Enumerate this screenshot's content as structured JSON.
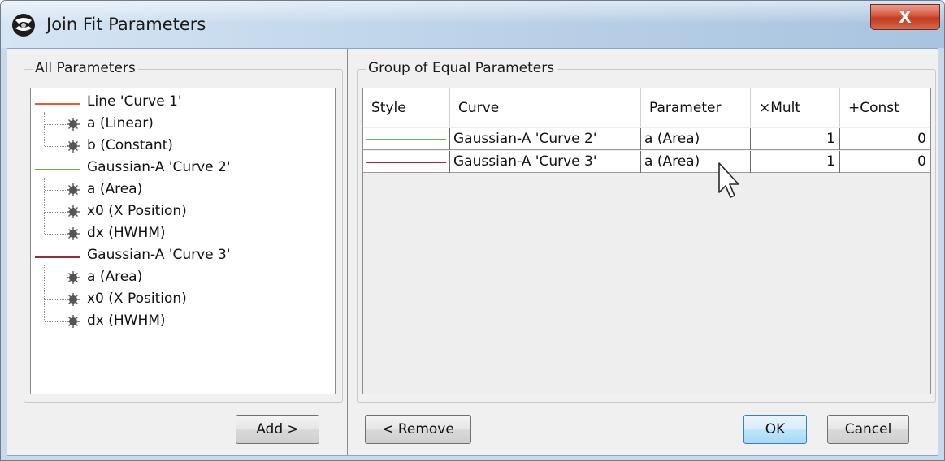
{
  "window": {
    "title": "Join Fit Parameters",
    "close_glyph": "X",
    "icon": "app-logo-icon"
  },
  "colors": {
    "curve1": "#f0582c",
    "curve2": "#6ab14b",
    "curve3": "#9b2a3a",
    "bullet": "#555555"
  },
  "all_parameters": {
    "title": "All Parameters",
    "curves": [
      {
        "label": "Line 'Curve 1'",
        "color_key": "curve1",
        "params": [
          "a (Linear)",
          "b (Constant)"
        ]
      },
      {
        "label": "Gaussian-A 'Curve 2'",
        "color_key": "curve2",
        "params": [
          "a (Area)",
          "x0 (X Position)",
          "dx (HWHM)"
        ]
      },
      {
        "label": "Gaussian-A 'Curve 3'",
        "color_key": "curve3",
        "params": [
          "a (Area)",
          "x0 (X Position)",
          "dx (HWHM)"
        ]
      }
    ],
    "add_button": "Add >"
  },
  "group": {
    "title": "Group of Equal Parameters",
    "columns": [
      "Style",
      "Curve",
      "Parameter",
      "×Mult",
      "+Const"
    ],
    "rows": [
      {
        "style_color": "#6ab14b",
        "curve": "Gaussian-A 'Curve 2'",
        "parameter": "a (Area)",
        "mult": "1",
        "const": "0"
      },
      {
        "style_color": "#9b2a3a",
        "curve": "Gaussian-A 'Curve 3'",
        "parameter": "a (Area)",
        "mult": "1",
        "const": "0"
      }
    ],
    "remove_button": "< Remove",
    "ok_button": "OK",
    "cancel_button": "Cancel"
  }
}
